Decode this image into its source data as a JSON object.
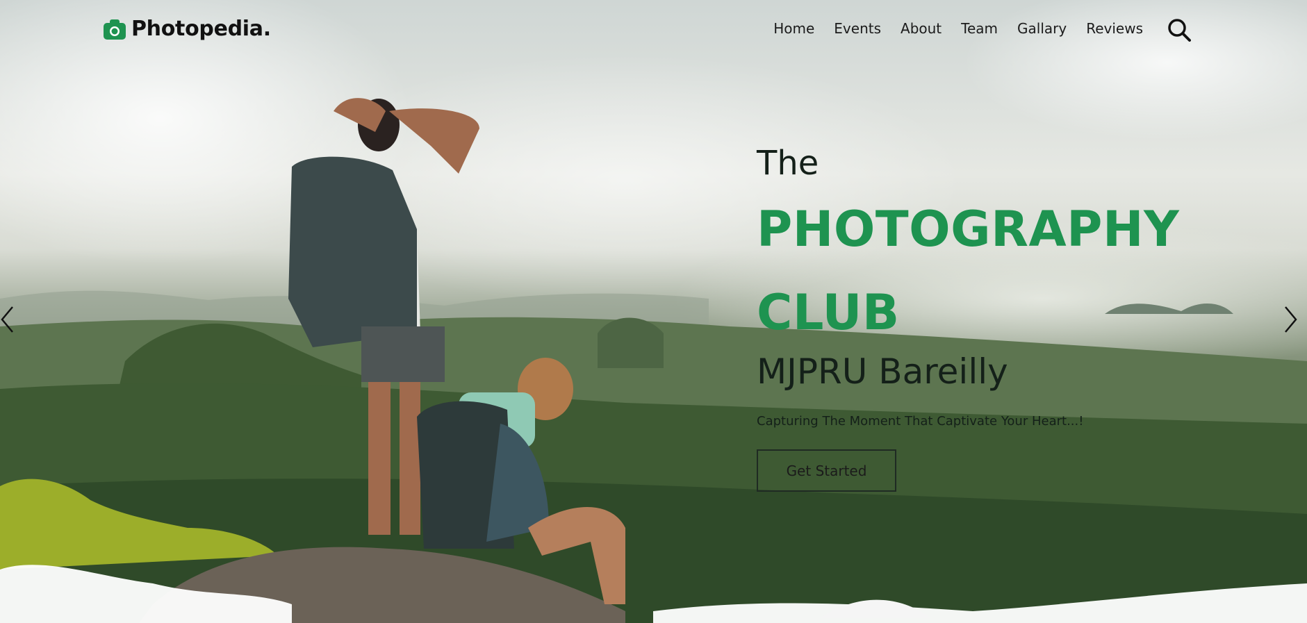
{
  "brand": {
    "name": "Photopedia",
    "dot": ".",
    "icon": "camera-icon",
    "accent": "#1e9350"
  },
  "nav": {
    "items": [
      {
        "label": "Home"
      },
      {
        "label": "Events"
      },
      {
        "label": "About"
      },
      {
        "label": "Team"
      },
      {
        "label": "Gallary"
      },
      {
        "label": "Reviews"
      }
    ],
    "search_icon": "search-icon"
  },
  "hero": {
    "title_prefix": "The",
    "title_line1": "PHOTOGRAPHY",
    "title_line2": "CLUB",
    "subtitle": "MJPRU Bareilly",
    "tagline": "Capturing The Moment That Captivate Your Heart...!",
    "cta_label": "Get Started",
    "prev_icon": "chevron-left-icon",
    "next_icon": "chevron-right-icon",
    "background": "hikers-on-mountain-cliff-photo"
  },
  "colors": {
    "accent": "#1e9350",
    "text_dark": "#142019"
  }
}
